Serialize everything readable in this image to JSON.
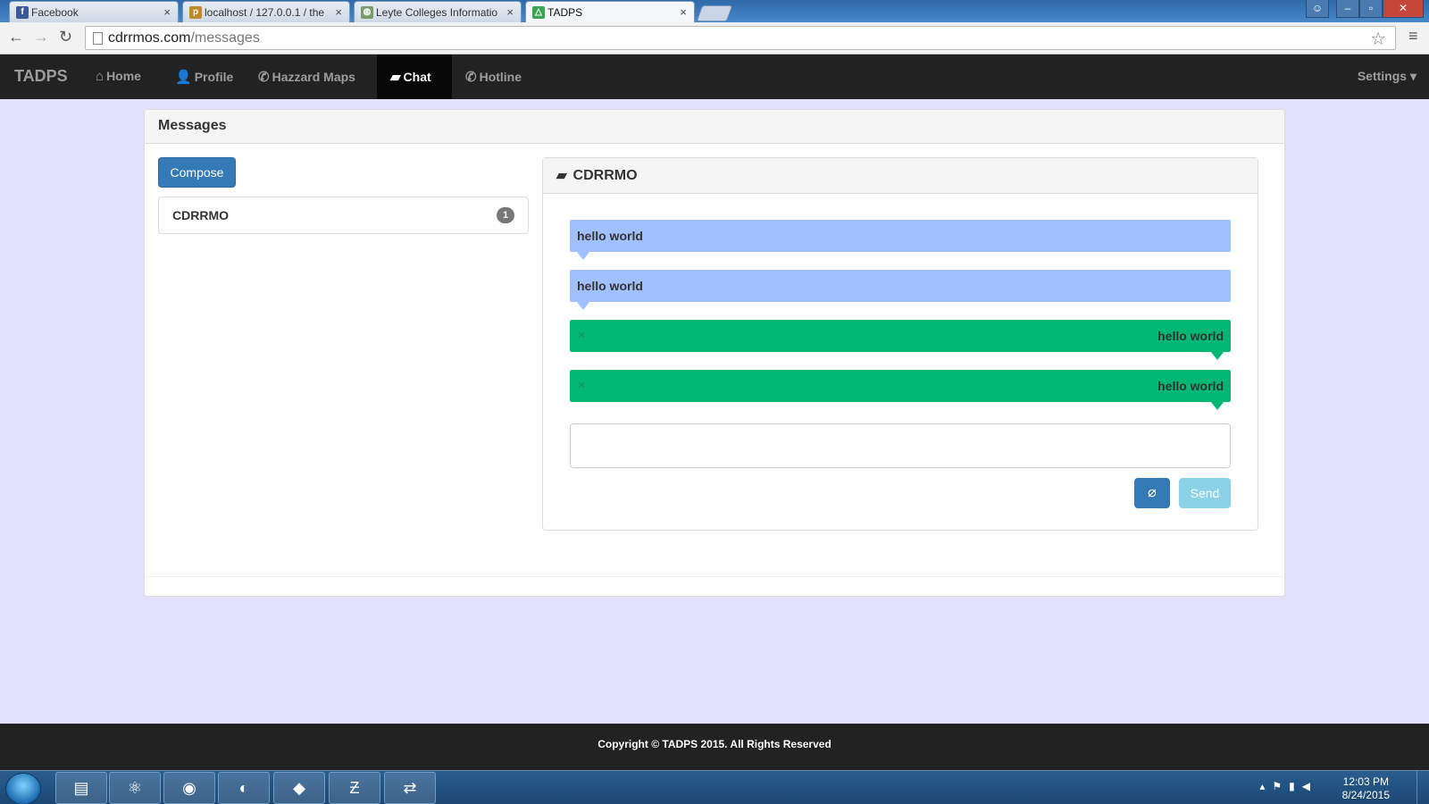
{
  "browser": {
    "tabs": [
      {
        "title": "Facebook",
        "icon": "facebook-icon",
        "color": "#3b5998",
        "glyph": "f"
      },
      {
        "title": "localhost / 127.0.0.1 / the",
        "icon": "phpmyadmin-icon",
        "color": "#c08a2b",
        "glyph": "p"
      },
      {
        "title": "Leyte Colleges Informatio",
        "icon": "globe-icon",
        "color": "#7a9c6a",
        "glyph": "◍"
      },
      {
        "title": "TADPS",
        "icon": "tadps-favicon",
        "color": "#3aa655",
        "glyph": "△"
      }
    ],
    "url_domain": "cdrrmos.com",
    "url_path": "/messages"
  },
  "navbar": {
    "brand": "TADPS",
    "items": [
      {
        "label": "Home",
        "icon": "home-icon",
        "glyph": "⌂"
      },
      {
        "label": "Profile",
        "icon": "user-icon",
        "glyph": "👤"
      },
      {
        "label": "Hazzard Maps",
        "icon": "phone-icon",
        "glyph": "✆"
      },
      {
        "label": "Chat",
        "icon": "chat-icon",
        "glyph": "▰"
      },
      {
        "label": "Hotline",
        "icon": "phone-icon",
        "glyph": "✆"
      }
    ],
    "settings": "Settings"
  },
  "messages_panel": {
    "title": "Messages",
    "compose": "Compose",
    "conversation": {
      "name": "CDRRMO",
      "unread": "1"
    }
  },
  "chat": {
    "title": "CDRRMO",
    "messages": [
      {
        "text": "hello world",
        "direction": "received"
      },
      {
        "text": "hello world",
        "direction": "received"
      },
      {
        "text": "hello world",
        "direction": "sent"
      },
      {
        "text": "hello world",
        "direction": "sent"
      }
    ],
    "delete_glyph": "×",
    "input_value": "",
    "send": "Send"
  },
  "footer": {
    "text": "Copyright © TADPS 2015. All Rights Reserved"
  },
  "taskbar": {
    "time": "12:03 PM",
    "date": "8/24/2015"
  },
  "colors": {
    "received_bubble": "#a0c0ff",
    "sent_bubble": "#00b773",
    "primary": "#337ab7",
    "info": "#5bc0de",
    "page_bg": "#e3e0fb"
  }
}
